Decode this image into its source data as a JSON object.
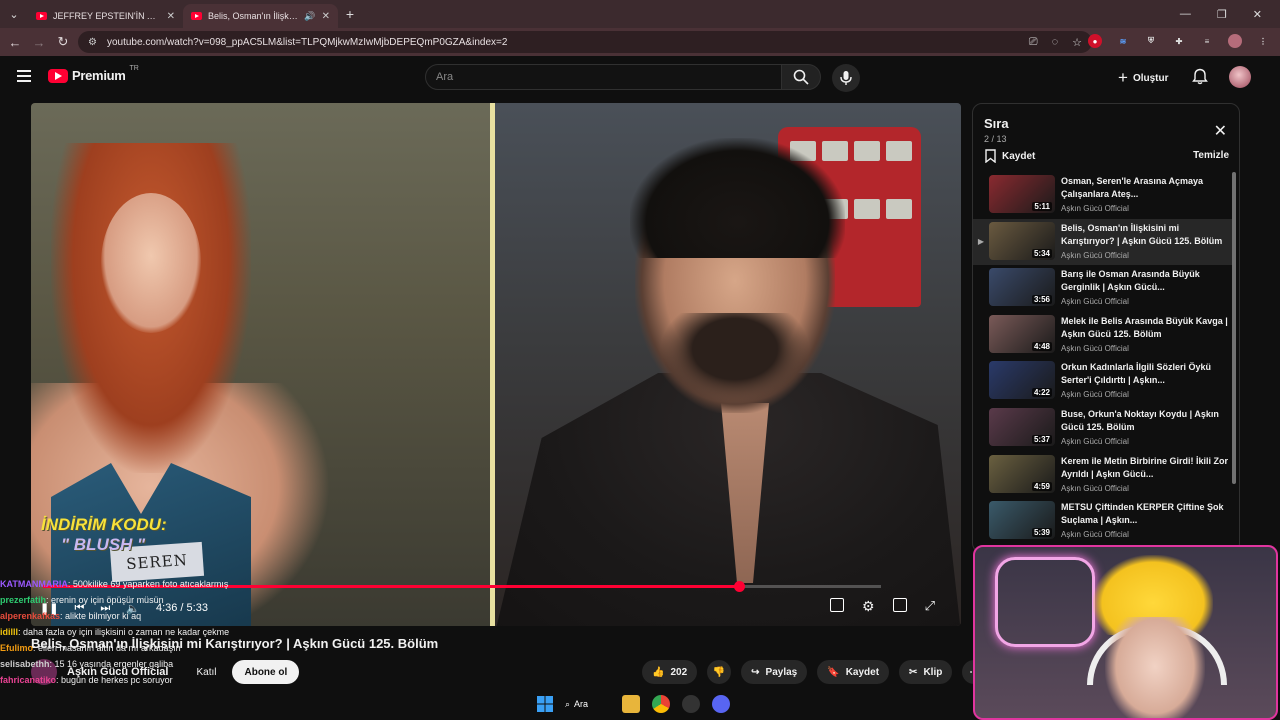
{
  "browser": {
    "tabs": [
      {
        "title": "JEFFREY EPSTEIN'İN ADASINA",
        "active": false
      },
      {
        "title": "Belis, Osman'ın İlişkisini mi",
        "active": true
      }
    ],
    "url": "youtube.com/watch?v=098_ppAC5LM&list=TLPQMjkwMzIwMjbDEPEQmP0GZA&index=2"
  },
  "header": {
    "logo_text": "Premium",
    "logo_country": "TR",
    "search_placeholder": "Ara",
    "create_label": "Oluştur"
  },
  "video": {
    "invite_line1": "İNDİRİM KODU:",
    "invite_line2": "\" BLUSH \"",
    "nametag": "SEREN",
    "time": "4:36 / 5:33",
    "progress": 0.83,
    "title": "Belis, Osman'ın İlişkisini mi Karıştırıyor? | Aşkın Gücü 125. Bölüm",
    "channel": "Aşkın Gücü Official",
    "join_label": "Katıl",
    "subscribe_label": "Abone ol",
    "likes": "202",
    "share_label": "Paylaş",
    "save_label": "Kaydet",
    "clip_label": "Klip"
  },
  "chat": [
    {
      "user": "KATMANMARIA",
      "text": ": 500kilike 69 yaparken foto atıcaklarmış",
      "color": "#9b59ff"
    },
    {
      "user": "prezerfatih",
      "text": ": erenin oy için öpüşür müsün",
      "color": "#2ecc71"
    },
    {
      "user": "alperenkafkas",
      "text": ": alikte bilmiyor ki aq",
      "color": "#e74c3c"
    },
    {
      "user": "idilll",
      "text": ": daha fazla oy için ilişkisini o zaman ne kadar çekme",
      "color": "#f1c40f"
    },
    {
      "user": "Efulimo",
      "text": ": elleri masanın altın da mı arkadaşın",
      "color": "#f39c12"
    },
    {
      "user": "selisabethh",
      "text": ": 15 16 yaşında ergenler galiba",
      "color": "#ccc"
    },
    {
      "user": "fahricanatiko",
      "text": ": bugün de herkes pc soruyor",
      "color": "#e84393"
    }
  ],
  "queue": {
    "title": "Sıra",
    "count": "2 / 13",
    "save_label": "Kaydet",
    "clear_label": "Temizle",
    "items": [
      {
        "title": "Osman, Seren'le Arasına Açmaya Çalışanlara Ateş...",
        "channel": "Aşkın Gücü Official",
        "duration": "5:11",
        "current": false,
        "thumb_color": "#8a2a30"
      },
      {
        "title": "Belis, Osman'ın İlişkisini mi Karıştırıyor? | Aşkın Gücü 125. Bölüm",
        "channel": "Aşkın Gücü Official",
        "duration": "5:34",
        "current": true,
        "thumb_color": "#6a5a40"
      },
      {
        "title": "Barış ile Osman Arasında Büyük Gerginlik | Aşkın Gücü...",
        "channel": "Aşkın Gücü Official",
        "duration": "3:56",
        "current": false,
        "thumb_color": "#3a4a6a"
      },
      {
        "title": "Melek ile Belis Arasında Büyük Kavga | Aşkın Gücü 125. Bölüm",
        "channel": "Aşkın Gücü Official",
        "duration": "4:48",
        "current": false,
        "thumb_color": "#7a5a58"
      },
      {
        "title": "Orkun Kadınlarla İlgili Sözleri Öykü Serter'i Çıldırttı | Aşkın...",
        "channel": "Aşkın Gücü Official",
        "duration": "4:22",
        "current": false,
        "thumb_color": "#2a3a6a"
      },
      {
        "title": "Buse, Orkun'a Noktayı Koydu | Aşkın Gücü 125. Bölüm",
        "channel": "Aşkın Gücü Official",
        "duration": "5:37",
        "current": false,
        "thumb_color": "#5a3a4a"
      },
      {
        "title": "Kerem ile Metin Birbirine Girdi! İkili Zor Ayrıldı | Aşkın Gücü...",
        "channel": "Aşkın Gücü Official",
        "duration": "4:59",
        "current": false,
        "thumb_color": "#6a6040"
      },
      {
        "title": "METSU Çiftinden KERPER Çiftine Şok Suçlama | Aşkın...",
        "channel": "Aşkın Gücü Official",
        "duration": "5:39",
        "current": false,
        "thumb_color": "#3a5a6a"
      }
    ]
  },
  "taskbar": {
    "search_label": "Ara"
  }
}
